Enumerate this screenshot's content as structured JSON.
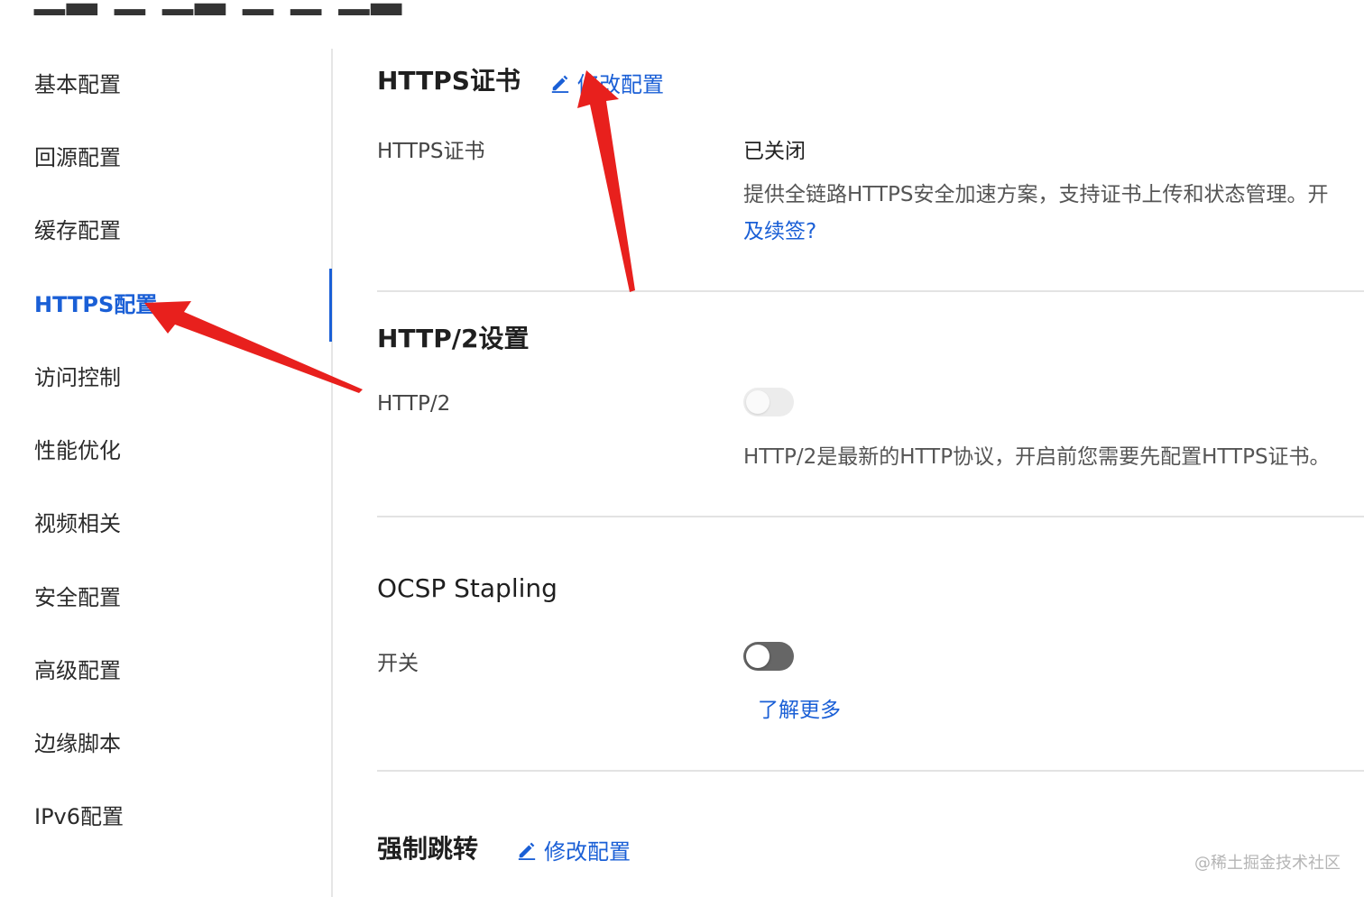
{
  "sidebar": {
    "items": [
      {
        "label": "基本配置"
      },
      {
        "label": "回源配置"
      },
      {
        "label": "缓存配置"
      },
      {
        "label": "HTTPS配置",
        "active": true
      },
      {
        "label": "访问控制"
      },
      {
        "label": "性能优化"
      },
      {
        "label": "视频相关"
      },
      {
        "label": "安全配置"
      },
      {
        "label": "高级配置"
      },
      {
        "label": "边缘脚本"
      },
      {
        "label": "IPv6配置"
      }
    ]
  },
  "https_cert": {
    "title": "HTTPS证书",
    "edit_label": "修改配置",
    "field_label": "HTTPS证书",
    "status": "已关闭",
    "description": "提供全链路HTTPS安全加速方案，支持证书上传和状态管理。开",
    "description_link": "及续签?"
  },
  "http2": {
    "title": "HTTP/2设置",
    "field_label": "HTTP/2",
    "toggle_state": "disabled",
    "description": "HTTP/2是最新的HTTP协议，开启前您需要先配置HTTPS证书。"
  },
  "ocsp": {
    "title": "OCSP Stapling",
    "field_label": "开关",
    "toggle_state": "off",
    "learn_more": "了解更多"
  },
  "force_redirect": {
    "title": "强制跳转",
    "edit_label": "修改配置"
  },
  "watermark": "@稀土掘金技术社区",
  "colors": {
    "accent": "#1a5fd6",
    "annotation_arrow": "#e8201d"
  },
  "icons": {
    "edit": "pencil-icon"
  }
}
